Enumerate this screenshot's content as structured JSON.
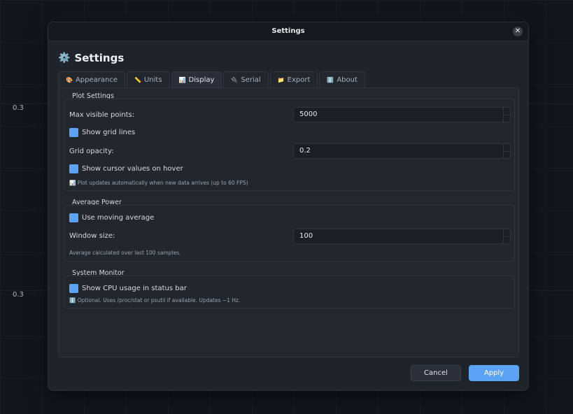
{
  "background": {
    "labels": [
      "0.3",
      "0.3"
    ]
  },
  "dialog": {
    "window_title": "Settings",
    "close_label": "✕",
    "heading_icon": "⚙️",
    "heading": "Settings",
    "tabs": [
      {
        "icon": "🎨",
        "label": "Appearance"
      },
      {
        "icon": "📏",
        "label": "Units"
      },
      {
        "icon": "📊",
        "label": "Display",
        "active": true
      },
      {
        "icon": "🔌",
        "label": "Serial"
      },
      {
        "icon": "📁",
        "label": "Export"
      },
      {
        "icon": "ℹ️",
        "label": "About"
      }
    ],
    "plot_settings": {
      "title": "Plot Settings",
      "max_points_label": "Max visible points:",
      "max_points_value": "5000",
      "show_grid_label": "Show grid lines",
      "grid_opacity_label": "Grid opacity:",
      "grid_opacity_value": "0.2",
      "show_cursor_label": "Show cursor values on hover",
      "note_icon": "📊",
      "note": "Plot updates automatically when new data arrives (up to 60 FPS)"
    },
    "average_power": {
      "title": "Average Power",
      "moving_average_label": "Use moving average",
      "window_size_label": "Window size:",
      "window_size_value": "100",
      "note": "Average calculated over last 100 samples."
    },
    "system_monitor": {
      "title": "System Monitor",
      "cpu_label": "Show CPU usage in status bar",
      "note_icon": "ℹ️",
      "note": "Optional. Uses /proc/stat or psutil if available. Updates ~1 Hz."
    },
    "buttons": {
      "cancel": "Cancel",
      "apply": "Apply"
    }
  },
  "colors": {
    "accent": "#5ba3f5",
    "dialog_bg": "#1f232a",
    "page_bg": "#12161c"
  }
}
